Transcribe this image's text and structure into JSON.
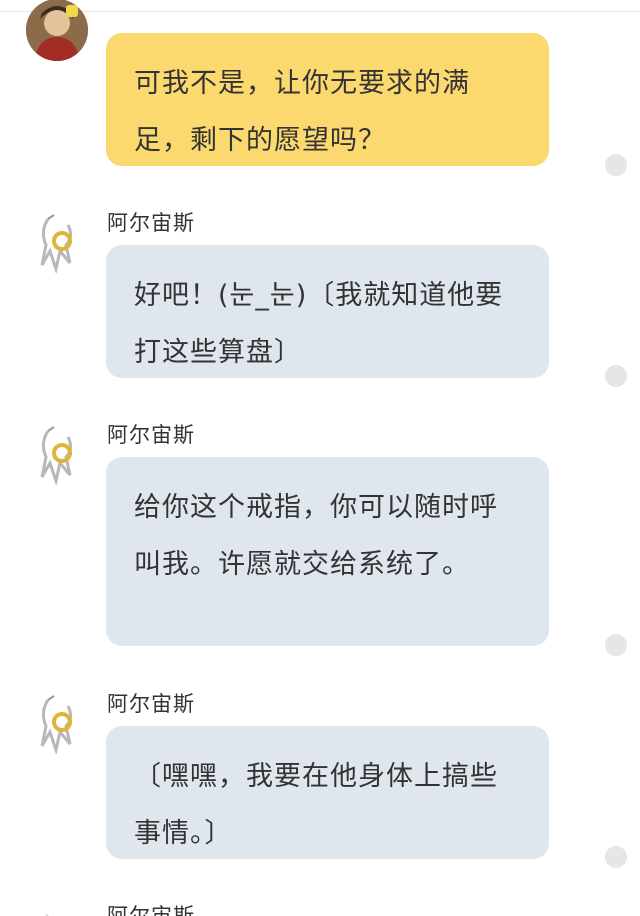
{
  "colors": {
    "self_bubble": "#fcd96f",
    "other_bubble": "#dfe6ee",
    "text": "#333333",
    "status_dot": "#e6e6e6"
  },
  "messages": [
    {
      "sender": "",
      "avatar": "trainer-avatar",
      "text": "可我不是，让你无要求的满足，剩下的愿望吗？"
    },
    {
      "sender": "阿尔宙斯",
      "avatar": "arceus-avatar",
      "text": "好吧！(눈_눈)〔我就知道他要打这些算盘〕"
    },
    {
      "sender": "阿尔宙斯",
      "avatar": "arceus-avatar",
      "text": "给你这个戒指，你可以随时呼叫我。许愿就交给系统了。"
    },
    {
      "sender": "阿尔宙斯",
      "avatar": "arceus-avatar",
      "text": "〔嘿嘿，我要在他身体上搞些事情。〕"
    },
    {
      "sender": "阿尔宙斯",
      "avatar": "arceus-avatar",
      "text": ""
    }
  ]
}
